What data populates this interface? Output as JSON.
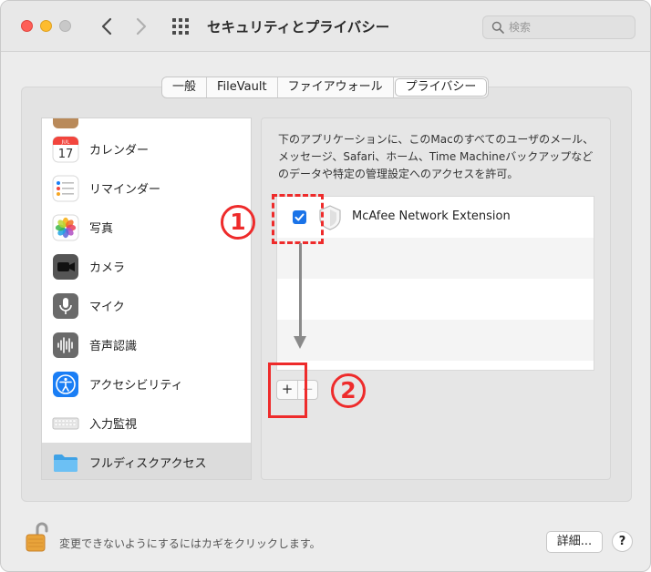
{
  "window": {
    "title": "セキュリティとプライバシー"
  },
  "search": {
    "placeholder": "検索"
  },
  "tabs": [
    {
      "label": "一般"
    },
    {
      "label": "FileVault"
    },
    {
      "label": "ファイアウォール"
    },
    {
      "label": "プライバシー",
      "selected": true
    }
  ],
  "sidebar": {
    "items": [
      {
        "label": "カレンダー",
        "icon": "calendar-icon",
        "icon_month": "JUL",
        "icon_day": "17"
      },
      {
        "label": "リマインダー",
        "icon": "reminders-icon"
      },
      {
        "label": "写真",
        "icon": "photos-icon"
      },
      {
        "label": "カメラ",
        "icon": "camera-icon"
      },
      {
        "label": "マイク",
        "icon": "microphone-icon"
      },
      {
        "label": "音声認識",
        "icon": "speech-recognition-icon"
      },
      {
        "label": "アクセシビリティ",
        "icon": "accessibility-icon"
      },
      {
        "label": "入力監視",
        "icon": "keyboard-icon"
      },
      {
        "label": "フルディスクアクセス",
        "icon": "folder-icon",
        "selected": true
      }
    ]
  },
  "main": {
    "description": "下のアプリケーションに、このMacのすべてのユーザのメール、メッセージ、Safari、ホーム、Time Machineバックアップなどのデータや特定の管理設定へのアクセスを許可。",
    "extensions": [
      {
        "label": "McAfee Network Extension",
        "checked": true,
        "icon": "shield-icon"
      }
    ],
    "add_label": "+",
    "remove_label": "−"
  },
  "annotations": {
    "step1": "1",
    "step2": "2"
  },
  "footer": {
    "lock_text": "変更できないようにするにはカギをクリックします。",
    "details_label": "詳細...",
    "help_label": "?"
  },
  "colors": {
    "annotation": "#ee2b2b",
    "checkbox": "#1a73e8",
    "selection": "#dcdcdc"
  }
}
